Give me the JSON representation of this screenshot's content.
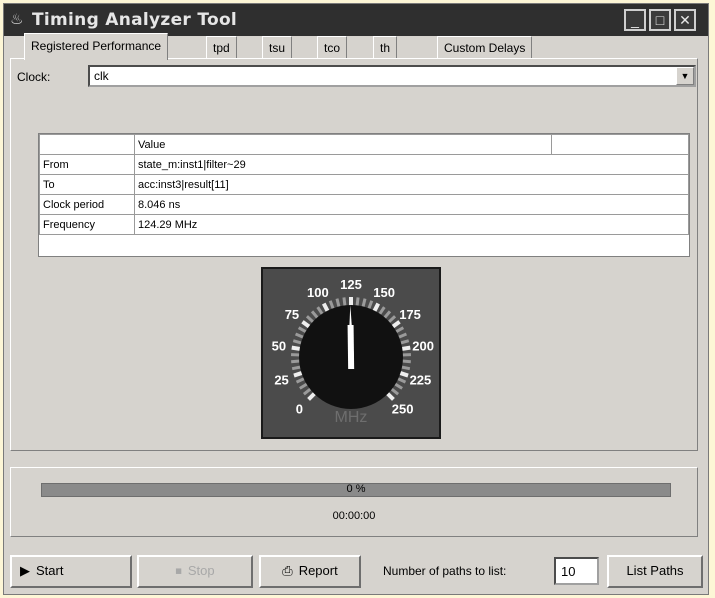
{
  "window": {
    "title": "Timing Analyzer Tool",
    "controls": {
      "minimize": "_",
      "maximize": "□",
      "close": "✕"
    }
  },
  "tabs": [
    {
      "label": "Registered Performance",
      "active": true
    },
    {
      "label": "tpd",
      "active": false
    },
    {
      "label": "tsu",
      "active": false
    },
    {
      "label": "tco",
      "active": false
    },
    {
      "label": "th",
      "active": false
    },
    {
      "label": "Custom Delays",
      "active": false
    }
  ],
  "clock": {
    "label": "Clock:",
    "value": "clk"
  },
  "results_table": {
    "header": [
      "",
      "Value",
      ""
    ],
    "rows": [
      {
        "name": "From",
        "value": "state_m:inst1|filter~29"
      },
      {
        "name": "To",
        "value": "acc:inst3|result[11]"
      },
      {
        "name": "Clock period",
        "value": "8.046 ns"
      },
      {
        "name": "Frequency",
        "value": "124.29 MHz"
      }
    ]
  },
  "gauge": {
    "unit": "MHz",
    "min": 0,
    "max": 250,
    "value": 124.29,
    "labels": [
      "0",
      "25",
      "50",
      "75",
      "100",
      "125",
      "150",
      "175",
      "200",
      "225",
      "250"
    ]
  },
  "progress": {
    "percent_text": "0 %",
    "fraction": 0,
    "elapsed": "00:00:00"
  },
  "buttons": {
    "start": "Start",
    "stop": "Stop",
    "report": "Report",
    "list_paths": "List Paths"
  },
  "paths": {
    "label": "Number of paths to list:",
    "value": "10"
  }
}
